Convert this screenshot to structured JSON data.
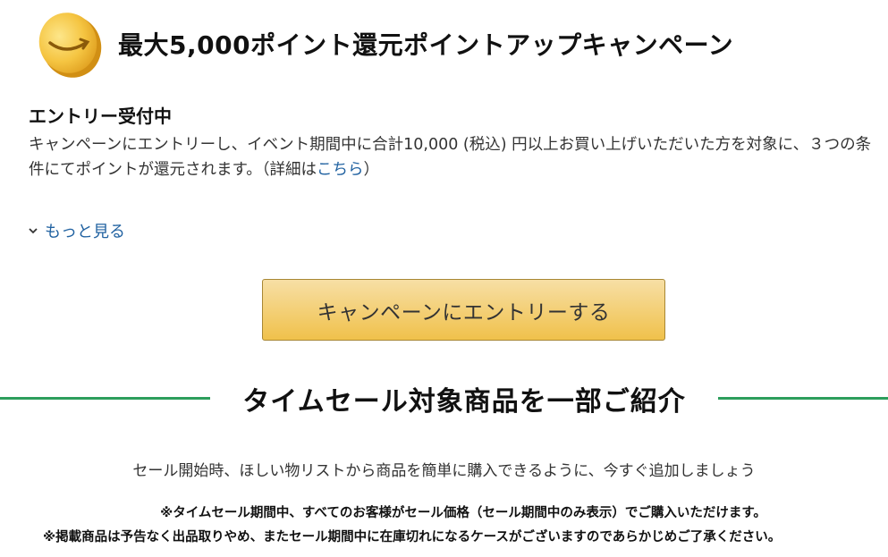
{
  "campaign": {
    "title": "最大5,000ポイント還元ポイントアップキャンペーン",
    "status": "エントリー受付中",
    "description": "キャンペーンにエントリーし、イベント期間中に合計10,000 (税込) 円以上お買い上げいただいた方を対象に、３つの条件にてポイントが還元されます。（詳細は",
    "details_link": "こちら",
    "description_end": "）",
    "more_label": "もっと見る",
    "entry_button": "キャンペーンにエントリーする"
  },
  "timesale": {
    "heading": "タイムセール対象商品を一部ご紹介",
    "subtext": "セール開始時、ほしい物リストから商品を簡単に購入できるように、今すぐ追加しましょう",
    "note1": "※タイムセール期間中、すべてのお客様がセール価格（セール期間中のみ表示）でご購入いただけます。",
    "note2": "※掲載商品は予告なく出品取りやめ、またセール期間中に在庫切れになるケースがございますのであらかじめご了承ください。"
  },
  "colors": {
    "link": "#2162a1",
    "divider": "#2d9e5c",
    "button_top": "#f7dfa5",
    "button_bottom": "#f0c14b"
  },
  "icons": {
    "coin": "amazon-coin-icon",
    "chevron": "chevron-down-icon"
  }
}
